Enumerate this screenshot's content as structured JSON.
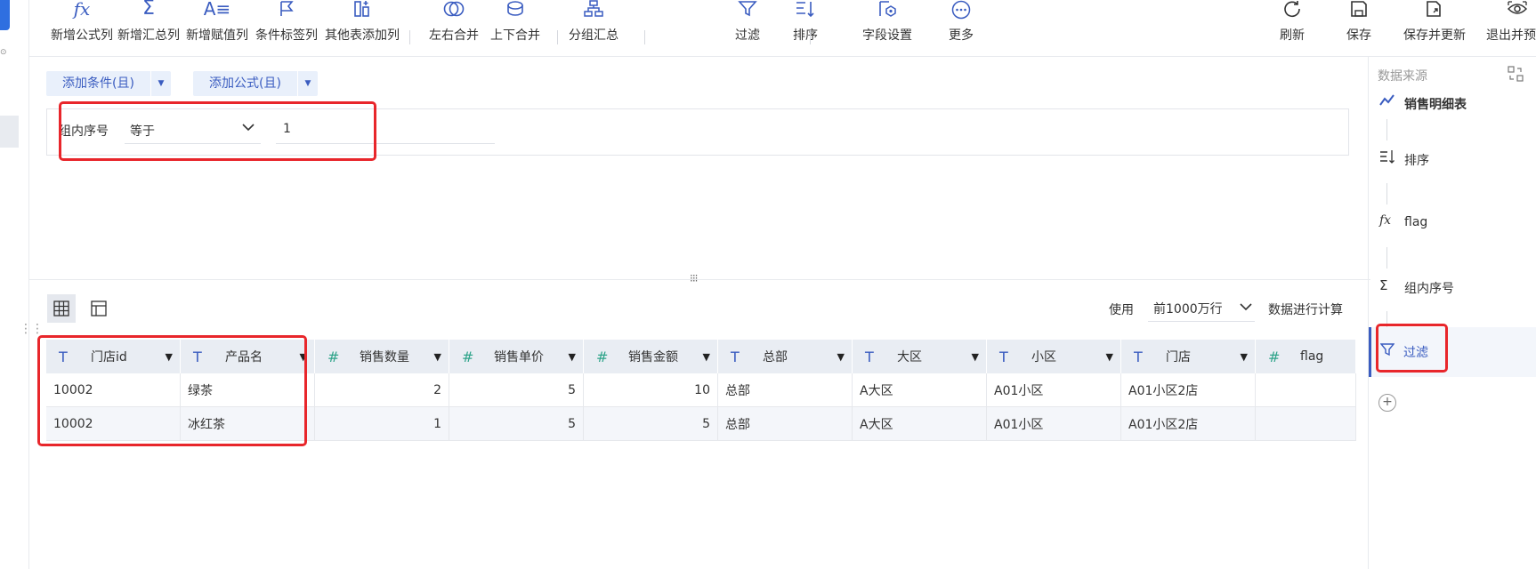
{
  "toolbar": {
    "items": [
      {
        "label": "新增公式列",
        "icon": "formula-icon"
      },
      {
        "label": "新增汇总列",
        "icon": "sigma-icon"
      },
      {
        "label": "新增赋值列",
        "icon": "assign-icon"
      },
      {
        "label": "条件标签列",
        "icon": "flag-tag-icon"
      },
      {
        "label": "其他表添加列",
        "icon": "add-column-icon"
      },
      {
        "label": "左右合并",
        "icon": "venn-icon"
      },
      {
        "label": "上下合并",
        "icon": "stack-merge-icon"
      },
      {
        "label": "分组汇总",
        "icon": "group-tree-icon"
      },
      {
        "label": "过滤",
        "icon": "filter-icon"
      },
      {
        "label": "排序",
        "icon": "sort-icon"
      },
      {
        "label": "字段设置",
        "icon": "field-settings-icon"
      },
      {
        "label": "更多",
        "icon": "more-icon"
      }
    ],
    "right_items": [
      {
        "label": "刷新",
        "icon": "refresh-icon"
      },
      {
        "label": "保存",
        "icon": "save-icon"
      },
      {
        "label": "保存并更新",
        "icon": "save-update-icon"
      },
      {
        "label": "退出并预览",
        "icon": "preview-icon"
      }
    ]
  },
  "conditions": {
    "add_condition_label": "添加条件(且)",
    "add_formula_label": "添加公式(且)",
    "field": "组内序号",
    "operator": "等于",
    "value": "1"
  },
  "data_bar": {
    "use_label": "使用",
    "row_limit": "前1000万行",
    "compute_label": "数据进行计算"
  },
  "table": {
    "columns": [
      {
        "name": "门店id",
        "type": "text"
      },
      {
        "name": "产品名",
        "type": "text"
      },
      {
        "name": "销售数量",
        "type": "number"
      },
      {
        "name": "销售单价",
        "type": "number"
      },
      {
        "name": "销售金额",
        "type": "number"
      },
      {
        "name": "总部",
        "type": "text"
      },
      {
        "name": "大区",
        "type": "text"
      },
      {
        "name": "小区",
        "type": "text"
      },
      {
        "name": "门店",
        "type": "text"
      },
      {
        "name": "flag",
        "type": "number"
      }
    ],
    "rows": [
      [
        "10002",
        "绿茶",
        "2",
        "5",
        "10",
        "总部",
        "A大区",
        "A01小区",
        "A01小区2店",
        ""
      ],
      [
        "10002",
        "冰红茶",
        "1",
        "5",
        "5",
        "总部",
        "A大区",
        "A01小区",
        "A01小区2店",
        ""
      ]
    ]
  },
  "steps_panel": {
    "title": "数据来源",
    "steps": [
      {
        "label": "销售明细表",
        "icon": "datasource-line-icon",
        "bold": true
      },
      {
        "label": "排序",
        "icon": "sort-icon"
      },
      {
        "label": "flag",
        "icon": "formula-icon"
      },
      {
        "label": "组内序号",
        "icon": "sigma-icon"
      },
      {
        "label": "过滤",
        "icon": "filter-icon",
        "active": true
      }
    ]
  },
  "colors": {
    "accent": "#3a5cc0",
    "highlight": "#e8262b",
    "numeric": "#2fa48a"
  }
}
